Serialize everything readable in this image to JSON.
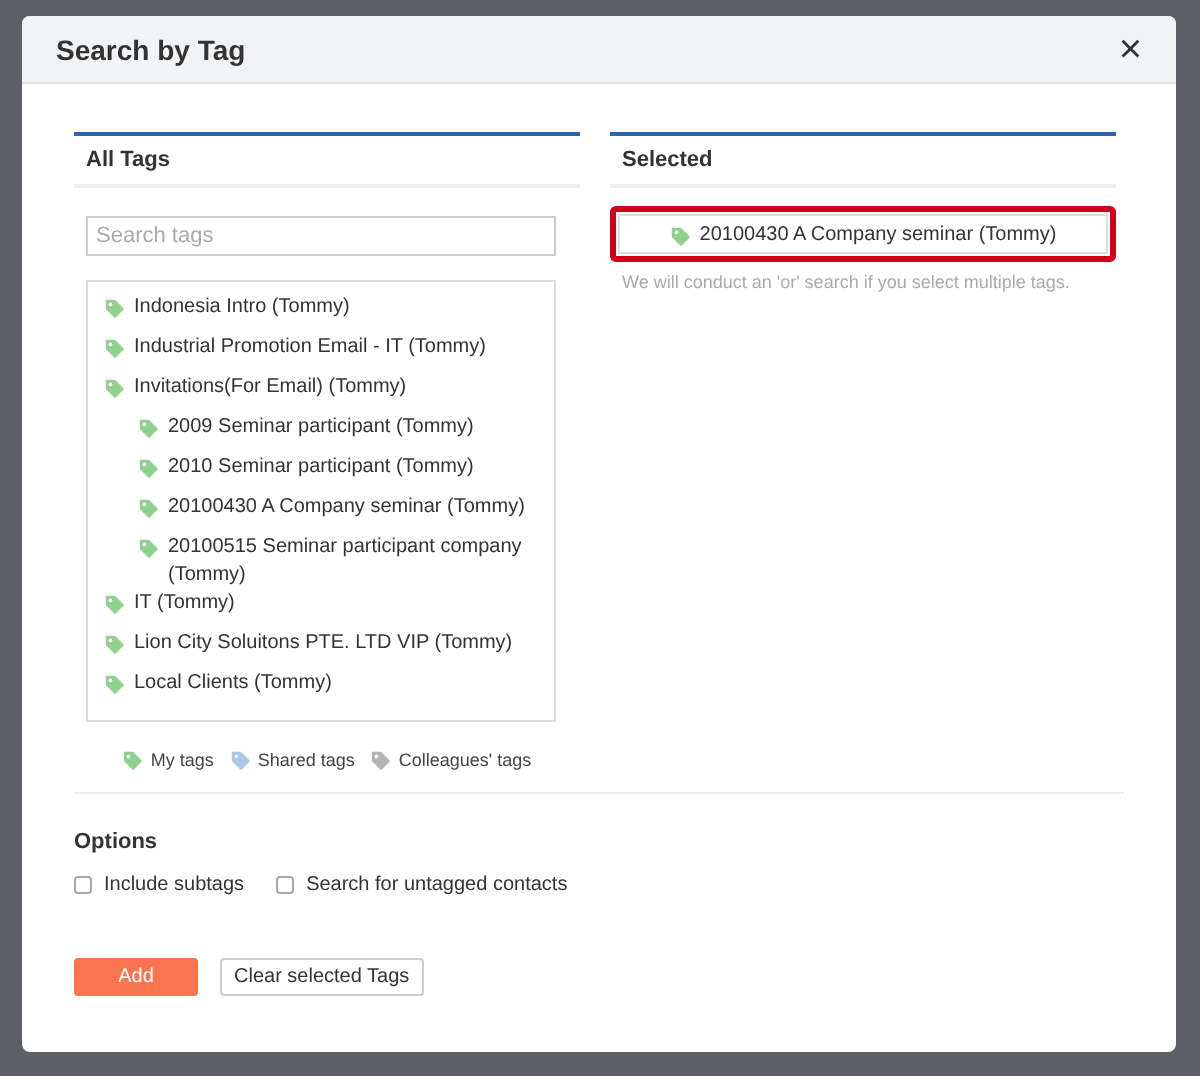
{
  "dialog": {
    "title": "Search by Tag",
    "close": "×"
  },
  "all_tags": {
    "title": "All Tags",
    "search": {
      "placeholder": "Search tags"
    },
    "tree": [
      {
        "label": "Indonesia Intro (Tommy)"
      },
      {
        "label": "Industrial Promotion Email - IT (Tommy)"
      },
      {
        "label": "Invitations(For Email) (Tommy)",
        "children": [
          {
            "label": "2009 Seminar participant (Tommy)"
          },
          {
            "label": "2010 Seminar participant (Tommy)"
          },
          {
            "label": "20100430 A Company seminar (Tommy)"
          },
          {
            "label": "20100515 Seminar participant company (Tommy)"
          }
        ]
      },
      {
        "label": "IT (Tommy)"
      },
      {
        "label": "Lion City Soluitons PTE. LTD VIP (Tommy)"
      },
      {
        "label": "Local Clients (Tommy)"
      }
    ],
    "legend": [
      {
        "label": "My tags",
        "color": "#8fd18f"
      },
      {
        "label": "Shared tags",
        "color": "#a9c8ea"
      },
      {
        "label": "Colleagues' tags",
        "color": "#b4b4b4"
      }
    ]
  },
  "selected": {
    "title": "Selected",
    "tags": [
      {
        "label": "20100430 A Company seminar (Tommy)",
        "highlighted": true
      }
    ],
    "hint": "We will conduct an 'or' search if you select multiple tags."
  },
  "options": {
    "title": "Options",
    "checkboxes": [
      {
        "label": "Include subtags",
        "checked": false
      },
      {
        "label": "Search for untagged contacts",
        "checked": false
      }
    ]
  },
  "buttons": [
    {
      "label": "Add",
      "kind": "primary"
    },
    {
      "label": "Clear selected Tags",
      "kind": "secondary"
    }
  ]
}
